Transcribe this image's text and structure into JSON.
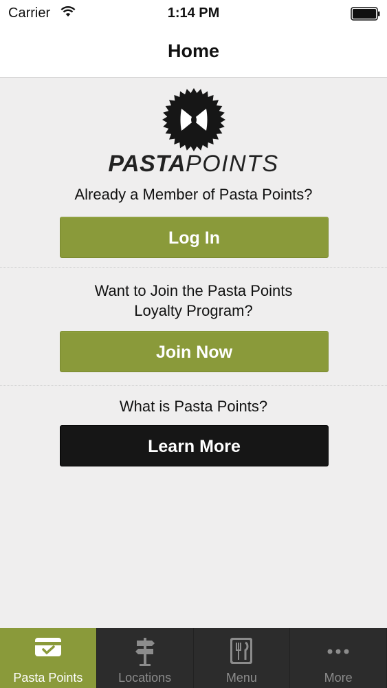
{
  "status_bar": {
    "carrier": "Carrier",
    "time": "1:14 PM"
  },
  "nav": {
    "title": "Home"
  },
  "logo": {
    "bold": "PASTA",
    "light": "POINTS"
  },
  "login": {
    "prompt": "Already a Member of Pasta Points?",
    "button": "Log In"
  },
  "join": {
    "prompt_line1": "Want to Join the Pasta Points",
    "prompt_line2": "Loyalty Program?",
    "button": "Join Now"
  },
  "learn": {
    "prompt": "What is Pasta Points?",
    "button": "Learn More"
  },
  "tabs": [
    {
      "label": "Pasta Points",
      "icon": "card-check-icon"
    },
    {
      "label": "Locations",
      "icon": "signpost-icon"
    },
    {
      "label": "Menu",
      "icon": "utensils-icon"
    },
    {
      "label": "More",
      "icon": "more-dots-icon"
    }
  ],
  "colors": {
    "accent": "#8a9a3a",
    "dark_button": "#161616",
    "tab_bar": "#2c2c2c"
  }
}
